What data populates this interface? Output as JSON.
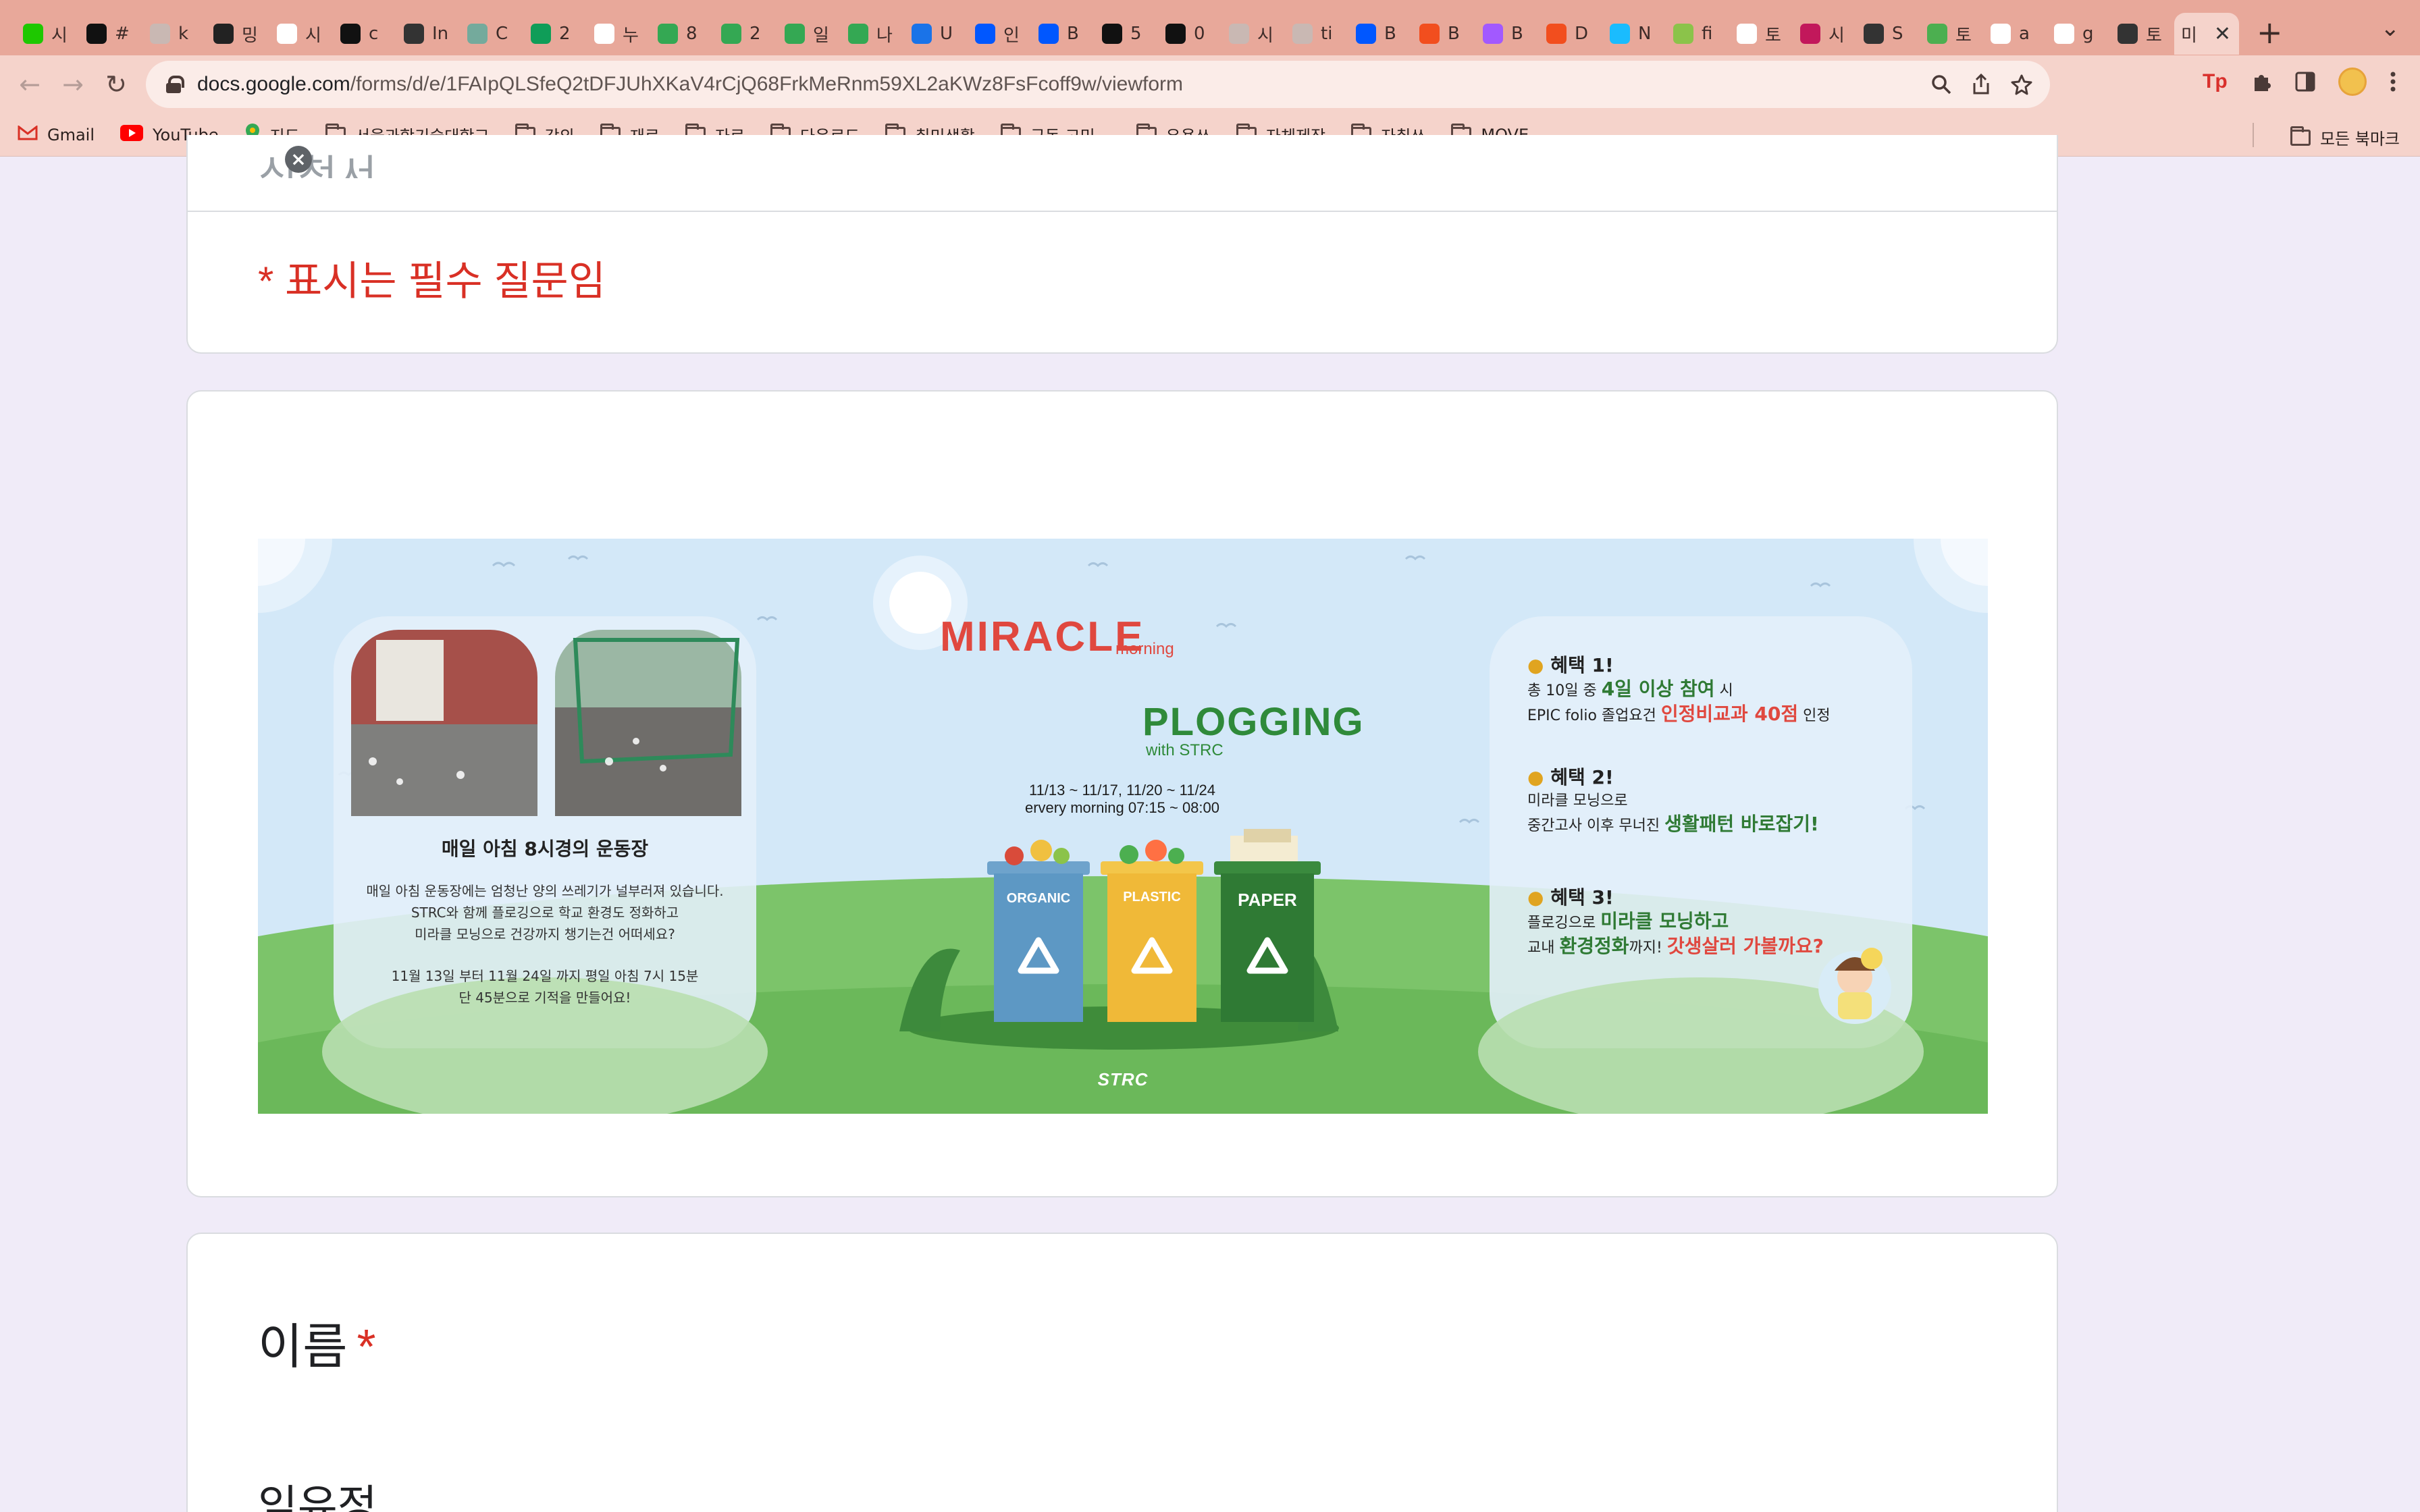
{
  "browser": {
    "tabs": [
      {
        "icon": "blog-icon",
        "letter": "시",
        "color": "#1ec800"
      },
      {
        "icon": "circle-icon",
        "letter": "#",
        "color": "#111111"
      },
      {
        "icon": "gray-circle-icon",
        "letter": "k",
        "color": "#c9b8b3"
      },
      {
        "icon": "sr-icon",
        "letter": "밍",
        "color": "#222222"
      },
      {
        "icon": "vup-icon",
        "letter": "시",
        "color": "#ffffff"
      },
      {
        "icon": "openai-icon",
        "letter": "c",
        "color": "#111111"
      },
      {
        "icon": "spiral-icon",
        "letter": "In",
        "color": "#333333"
      },
      {
        "icon": "chatgpt-icon",
        "letter": "C",
        "color": "#74aa9c"
      },
      {
        "icon": "plus-green-icon",
        "letter": "2",
        "color": "#0f9d58"
      },
      {
        "icon": "google-icon",
        "letter": "누",
        "color": "#ffffff"
      },
      {
        "icon": "drive-icon",
        "letter": "8",
        "color": "#34a853"
      },
      {
        "icon": "drive-icon",
        "letter": "2",
        "color": "#34a853"
      },
      {
        "icon": "drive-icon",
        "letter": "일",
        "color": "#34a853"
      },
      {
        "icon": "drive-icon",
        "letter": "나",
        "color": "#34a853"
      },
      {
        "icon": "signature-icon",
        "letter": "U",
        "color": "#1a73e8"
      },
      {
        "icon": "behance-icon",
        "letter": "인",
        "color": "#0057ff"
      },
      {
        "icon": "behance-icon",
        "letter": "B",
        "color": "#0057ff"
      },
      {
        "icon": "black-square-icon",
        "letter": "5",
        "color": "#111111"
      },
      {
        "icon": "openai-icon",
        "letter": "0",
        "color": "#111111"
      },
      {
        "icon": "gray-circle-icon",
        "letter": "시",
        "color": "#c9b8b3"
      },
      {
        "icon": "gray-circle-icon",
        "letter": "ti",
        "color": "#c9b8b3"
      },
      {
        "icon": "behance-icon",
        "letter": "B",
        "color": "#0057ff"
      },
      {
        "icon": "figma-icon",
        "letter": "B",
        "color": "#f24e1e"
      },
      {
        "icon": "figma-icon",
        "letter": "B",
        "color": "#a259ff"
      },
      {
        "icon": "figma-icon",
        "letter": "D",
        "color": "#f24e1e"
      },
      {
        "icon": "figma-icon",
        "letter": "N",
        "color": "#1abcfe"
      },
      {
        "icon": "target-icon",
        "letter": "fi",
        "color": "#8bc34a"
      },
      {
        "icon": "wix-icon",
        "letter": "토",
        "color": "#ffffff"
      },
      {
        "icon": "puzzle-color-icon",
        "letter": "시",
        "color": "#c2185b"
      },
      {
        "icon": "slash-icon",
        "letter": "S",
        "color": "#333333"
      },
      {
        "icon": "leaf-icon",
        "letter": "토",
        "color": "#4caf50"
      },
      {
        "icon": "google-icon",
        "letter": "a",
        "color": "#ffffff"
      },
      {
        "icon": "google-icon",
        "letter": "g",
        "color": "#ffffff"
      },
      {
        "icon": "slash-icon",
        "letter": "토",
        "color": "#333333"
      }
    ],
    "active_tab": {
      "letter": "미",
      "close": "✕"
    },
    "new_tab": "+",
    "tab_list": "⌄",
    "url_host": "docs.google.com",
    "url_path": "/forms/d/e/1FAIpQLSfeQ2tDFJUhXKaV4rCjQ68FrkMeRnm59XL2aKWz8FsFcoff9w/viewform",
    "back": "←",
    "forward": "→",
    "reload": "↻",
    "ext_tp": "Tp",
    "bookmarks": [
      {
        "icon": "gmail-icon",
        "label": "Gmail"
      },
      {
        "icon": "youtube-icon",
        "label": "YouTube"
      },
      {
        "icon": "maps-icon",
        "label": "지도"
      },
      {
        "icon": "folder-icon",
        "label": "서울과학기술대학교"
      },
      {
        "icon": "folder-icon",
        "label": "강의"
      },
      {
        "icon": "folder-icon",
        "label": "재료"
      },
      {
        "icon": "folder-icon",
        "label": "자료"
      },
      {
        "icon": "folder-icon",
        "label": "다운로드"
      },
      {
        "icon": "folder-icon",
        "label": "취미생활"
      },
      {
        "icon": "folder-icon",
        "label": "구독 고민,,,"
      },
      {
        "icon": "folder-icon",
        "label": "유용쓰"
      },
      {
        "icon": "folder-icon",
        "label": "자체제작"
      },
      {
        "icon": "folder-icon",
        "label": "자취쓰"
      },
      {
        "icon": "folder-icon",
        "label": "MOVE"
      }
    ],
    "all_bookmarks": "모든 북마크"
  },
  "form": {
    "header_cut": "신청서",
    "required_note": "* 표시는 필수 질문임",
    "banner": {
      "brand": "MIRACLE",
      "brand_small": "morning",
      "plogging": "PLOGGING",
      "with": "with STRC",
      "dates": "11/13 ~ 11/17, 11/20 ~ 11/24",
      "time": "ervery morning 07:15 ~ 08:00",
      "bins": [
        "ORGANIC",
        "PLASTIC",
        "PAPER"
      ],
      "left_title": "매일 아침 8시경의 운동장",
      "left_body": [
        "매일 아침 운동장에는 엄청난 양의 쓰레기가 널부러져 있습니다.",
        "STRC와 함께 플로깅으로 학교 환경도 정화하고",
        "미라클 모닝으로 건강까지 챙기는건 어떠세요?"
      ],
      "left_footer": [
        "11월 13일 부터 11월 24일 까지 평일 아침 7시 15분",
        "단 45분으로 기적을 만들어요!"
      ],
      "benefit1_title": "혜택 1!",
      "benefit1_line1_a": "총 10일 중 ",
      "benefit1_line1_b": "4일 이상 참여",
      "benefit1_line1_c": " 시",
      "benefit1_line2_a": "EPIC folio 졸업요건 ",
      "benefit1_line2_b": "인정비교과 40점",
      "benefit1_line2_c": " 인정",
      "benefit2_title": "혜택 2!",
      "benefit2_line1": "미라클 모닝으로",
      "benefit2_line2_a": "중간고사 이후 무너진 ",
      "benefit2_line2_b": "생활패턴 바로잡기!",
      "benefit3_title": "혜택 3!",
      "benefit3_line1_a": "플로깅으로 ",
      "benefit3_line1_b": "미라클 모닝하고",
      "benefit3_line2_a": "교내 ",
      "benefit3_line2_b": "환경정화",
      "benefit3_line2_c": "까지! ",
      "benefit3_line2_d": "갓생살러 가볼까요?",
      "logo": "STRC"
    },
    "question_name": {
      "title": "이름",
      "required_mark": "*",
      "answer": "임유정"
    }
  },
  "colors": {
    "tab_bar": "#e8a89a",
    "toolbar": "#f5d3cb",
    "page_bg": "#f0ebf8",
    "required": "#d93025",
    "banner_bg": "#d3e8f8"
  }
}
